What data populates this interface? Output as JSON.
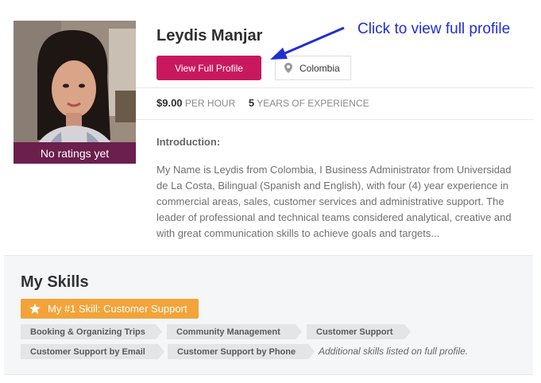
{
  "profile": {
    "name": "Leydis Manjar",
    "ratings_text": "No ratings yet",
    "view_button_label": "View Full Profile",
    "location": "Colombia",
    "rate_amount": "$9.00",
    "rate_unit": "PER HOUR",
    "experience_years": "5",
    "experience_unit": "YEARS OF EXPERIENCE",
    "intro_title": "Introduction:",
    "intro_text": "My Name is Leydis from Colombia, I Business Administrator from Universidad de La Costa, Bilingual (Spanish and English), with four (4) year experience in commercial areas, sales, customer services and administrative support. The leader of professional and technical teams considered analytical, creative and with great communication skills to achieve goals and targets..."
  },
  "annotation": {
    "text": "Click to view full profile",
    "color": "#1f2fd4"
  },
  "skills": {
    "title": "My Skills",
    "top_skill_label": "My #1 Skill: Customer Support",
    "tags": [
      "Booking & Organizing Trips",
      "Community Management",
      "Customer Support",
      "Customer Support by Email",
      "Customer Support by Phone"
    ],
    "more_note": "Additional skills listed on full profile."
  },
  "colors": {
    "primary_button": "#c8195e",
    "ratings_bar": "#6b1f4c",
    "top_skill": "#f2a43a",
    "skills_panel": "#f4f6f7"
  },
  "icons": [
    "location-pin-icon",
    "star-icon",
    "arrow-icon"
  ]
}
